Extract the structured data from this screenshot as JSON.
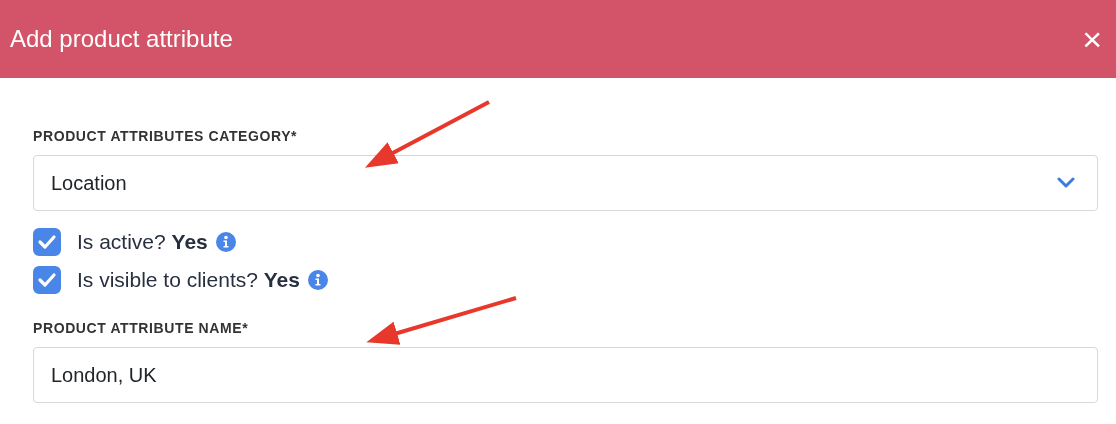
{
  "dialog": {
    "title": "Add product attribute",
    "close_icon": "×"
  },
  "fields": [
    {
      "kind": "select",
      "label": "PRODUCT ATTRIBUTES CATEGORY*",
      "value": "Location"
    },
    {
      "kind": "checkboxes",
      "options": [
        {
          "label": "Is active? **Yes**",
          "checked": true
        },
        {
          "label": "Is visible to clients? **Yes**",
          "checked": true
        }
      ]
    },
    {
      "kind": "text",
      "label": "PRODUCT ATTRIBUTE NAME*",
      "value": "London, UK"
    }
  ]
}
